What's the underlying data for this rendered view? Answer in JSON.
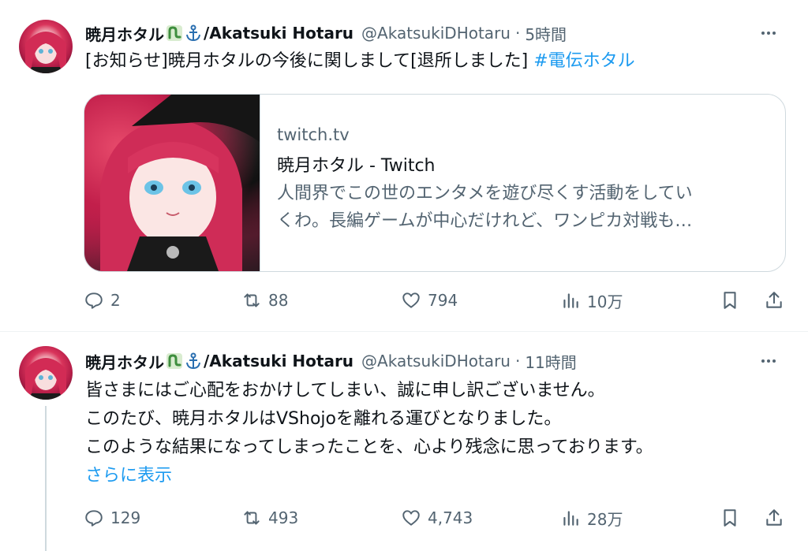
{
  "tweets": [
    {
      "display_name": "暁月ホタル",
      "name_suffix": "/Akatsuki Hotaru",
      "name_icons": [
        "seedling-emoji-icon",
        "anchor-emoji-icon"
      ],
      "handle": "@AkatsukiDHotaru",
      "separator": "·",
      "time": "5時間",
      "text": "[お知らせ]暁月ホタルの今後に関しまして[退所しました]",
      "hashtag": "#電伝ホタル",
      "card": {
        "domain": "twitch.tv",
        "title": "暁月ホタル - Twitch",
        "description_lines": [
          "人間界でこの世のエンタメを遊び尽くす活動をしてい",
          "くわ。長編ゲームが中心だけれど、ワンピカ対戦も…"
        ]
      },
      "stats": {
        "replies": "2",
        "reposts": "88",
        "likes": "794",
        "views": "10万"
      }
    },
    {
      "display_name": "暁月ホタル",
      "name_suffix": "/Akatsuki Hotaru",
      "name_icons": [
        "seedling-emoji-icon",
        "anchor-emoji-icon"
      ],
      "handle": "@AkatsukiDHotaru",
      "separator": "·",
      "time": "11時間",
      "lines": [
        "皆さまにはご心配をおかけしてしまい、誠に申し訳ございません。",
        "このたび、暁月ホタルはVShojoを離れる運びとなりました。",
        "このような結果になってしまったことを、心より残念に思っております。"
      ],
      "show_more": "さらに表示",
      "stats": {
        "replies": "129",
        "reposts": "493",
        "likes": "4,743",
        "views": "28万"
      }
    }
  ],
  "colors": {
    "link": "#1d9bf0",
    "secondary_text": "#536471",
    "primary_text": "#0f1419",
    "border": "#cfd9de"
  }
}
